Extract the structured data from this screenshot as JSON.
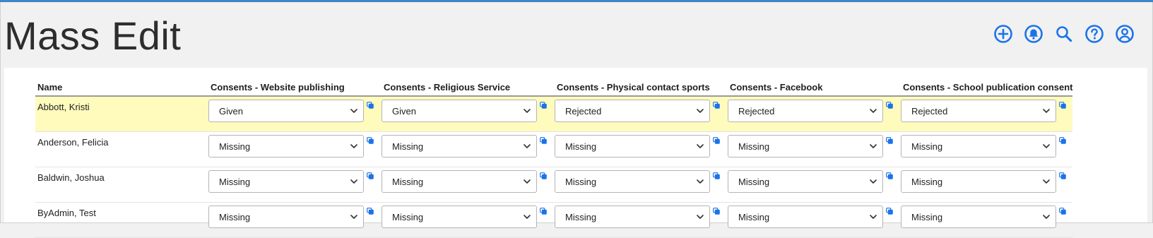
{
  "page": {
    "title": "Mass Edit"
  },
  "header": {
    "icons": [
      "add-circle-icon",
      "bell-icon",
      "search-icon",
      "help-icon",
      "account-icon"
    ],
    "accent_color": "#1a73e8"
  },
  "table": {
    "columns": [
      "Name",
      "Consents - Website publishing",
      "Consents - Religious Service",
      "Consents - Physical contact sports",
      "Consents - Facebook",
      "Consents - School publication consent"
    ],
    "rows": [
      {
        "name": "Abbott, Kristi",
        "values": [
          "Given",
          "Given",
          "Rejected",
          "Rejected",
          "Rejected"
        ]
      },
      {
        "name": "Anderson, Felicia",
        "values": [
          "Missing",
          "Missing",
          "Missing",
          "Missing",
          "Missing"
        ]
      },
      {
        "name": "Baldwin, Joshua",
        "values": [
          "Missing",
          "Missing",
          "Missing",
          "Missing",
          "Missing"
        ]
      },
      {
        "name": "ByAdmin, Test",
        "values": [
          "Missing",
          "Missing",
          "Missing",
          "Missing",
          "Missing"
        ]
      }
    ],
    "highlight_color": "#fffbbd"
  }
}
